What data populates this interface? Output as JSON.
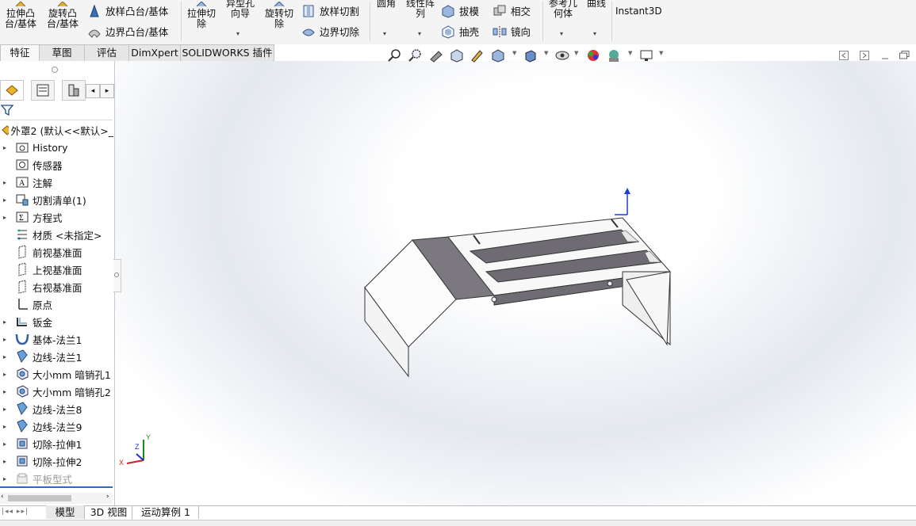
{
  "ribbon": {
    "extrude_boss": "拉伸凸\n台/基体",
    "revolve_boss": "旋转凸\n台/基体",
    "loft_boss": "放样凸台/基体",
    "boundary_boss": "边界凸台/基体",
    "extrude_cut": "拉伸切\n除",
    "hole_wizard": "异型孔\n向导",
    "revolve_cut": "旋转切\n除",
    "loft_cut": "放样切割",
    "boundary_cut": "边界切除",
    "fillet": "圆角",
    "linear_pattern": "线性阵\n列",
    "draft": "拔模",
    "shell": "抽壳",
    "intersect": "相交",
    "mirror": "镜向",
    "ref_geometry": "参考几\n何体",
    "curves": "曲线",
    "instant3d": "Instant3D"
  },
  "command_tabs": [
    "特征",
    "草图",
    "评估",
    "DimXpert",
    "SOLIDWORKS 插件"
  ],
  "active_command_tab": "特征",
  "feature_tree": {
    "root": "外罩2 (默认<<默认>_",
    "items": [
      {
        "label": "History",
        "icon": "history-folder-icon",
        "expandable": true
      },
      {
        "label": "传感器",
        "icon": "sensor-icon",
        "expandable": false
      },
      {
        "label": "注解",
        "icon": "annotation-icon",
        "expandable": true
      },
      {
        "label": "切割清单(1)",
        "icon": "cut-list-icon",
        "expandable": true
      },
      {
        "label": "方程式",
        "icon": "equation-icon",
        "expandable": true
      },
      {
        "label": "材质 <未指定>",
        "icon": "material-icon",
        "expandable": false
      },
      {
        "label": "前视基准面",
        "icon": "plane-icon",
        "expandable": false
      },
      {
        "label": "上视基准面",
        "icon": "plane-icon",
        "expandable": false
      },
      {
        "label": "右视基准面",
        "icon": "plane-icon",
        "expandable": false
      },
      {
        "label": "原点",
        "icon": "origin-icon",
        "expandable": false
      },
      {
        "label": "钣金",
        "icon": "sheet-metal-icon",
        "expandable": true
      },
      {
        "label": "基体-法兰1",
        "icon": "base-flange-icon",
        "expandable": true
      },
      {
        "label": "边线-法兰1",
        "icon": "edge-flange-icon",
        "expandable": true
      },
      {
        "label": "大小mm 暗销孔1",
        "icon": "hole-icon",
        "expandable": true
      },
      {
        "label": "大小mm 暗销孔2",
        "icon": "hole-icon",
        "expandable": true
      },
      {
        "label": "边线-法兰8",
        "icon": "edge-flange-icon",
        "expandable": true
      },
      {
        "label": "边线-法兰9",
        "icon": "edge-flange-icon",
        "expandable": true
      },
      {
        "label": "切除-拉伸1",
        "icon": "cut-extrude-icon",
        "expandable": true
      },
      {
        "label": "切除-拉伸2",
        "icon": "cut-extrude-icon",
        "expandable": true
      },
      {
        "label": "平板型式",
        "icon": "flat-pattern-icon",
        "expandable": true,
        "suppressed": true
      }
    ]
  },
  "bottom_tabs": [
    "模型",
    "3D 视图",
    "运动算例 1"
  ],
  "active_bottom_tab": "模型",
  "triad": {
    "x": "X",
    "y": "Y",
    "z": "Z"
  },
  "colors": {
    "accent": "#1a5fb4",
    "ribbon_bg": "#f4f4f4",
    "tab_active": "#f8f8f8"
  }
}
